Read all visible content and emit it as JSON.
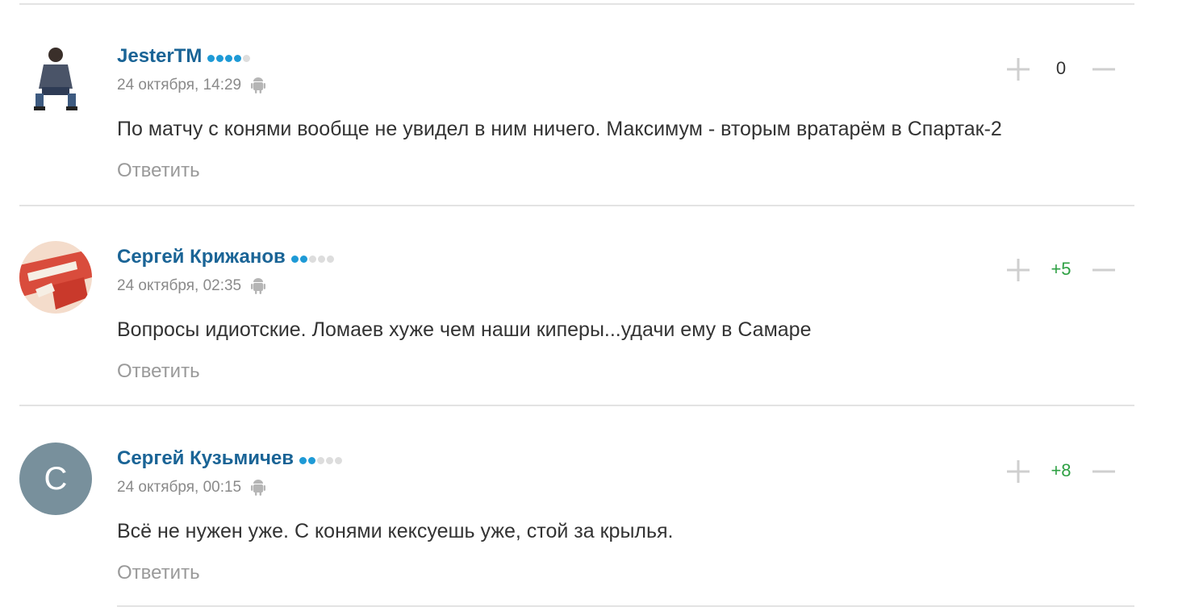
{
  "reply_label": "Ответить",
  "comments": [
    {
      "author": "JesterTM",
      "rank_filled": 4,
      "date": "24 октября, 14:29",
      "platform_icon": "android-icon",
      "text": "По матчу с конями вообще не увидел в ним ничего. Максимум - вторым вратарём в Спартак-2",
      "score": "0",
      "avatar_type": "photo-person-sitting"
    },
    {
      "author": "Сергей Крижанов",
      "rank_filled": 2,
      "date": "24 октября, 02:35",
      "platform_icon": "android-icon",
      "text": "Вопросы идиотские. Ломаев хуже чем наши киперы...удачи ему в Самаре",
      "score": "+5",
      "avatar_type": "photo-spartak-scarf"
    },
    {
      "author": "Сергей Кузьмичев",
      "rank_filled": 2,
      "date": "24 октября, 00:15",
      "platform_icon": "android-icon",
      "text": "Всё не нужен уже. С конями кексуешь уже, стой за крылья.",
      "score": "+8",
      "avatar_letter": "С",
      "avatar_color": "#78909c"
    }
  ],
  "colors": {
    "author": "#1a6496",
    "rank_on": "#1e9ad6",
    "positive": "#2ea043"
  }
}
